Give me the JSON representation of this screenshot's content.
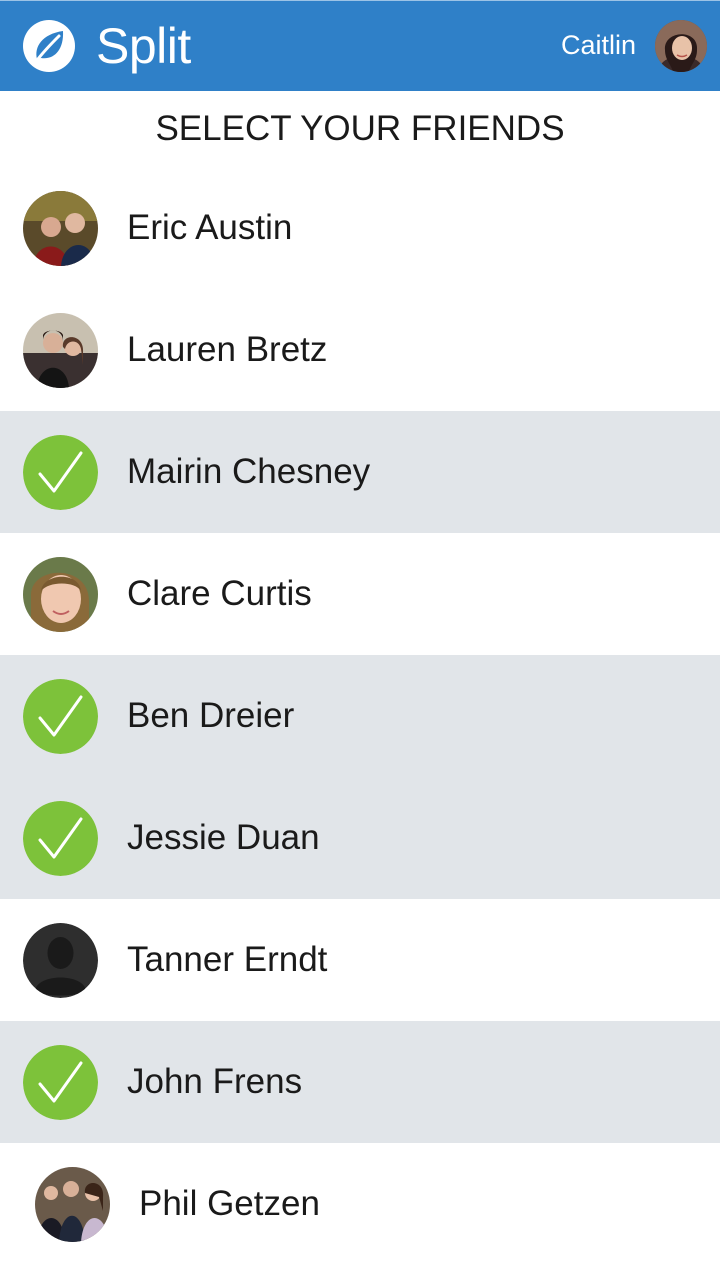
{
  "header": {
    "app_name": "Split",
    "logo_icon": "leaf-icon",
    "user_name": "Caitlin",
    "background_color": "#2f80c8"
  },
  "page": {
    "title": "SELECT YOUR FRIENDS"
  },
  "colors": {
    "selected_row": "#e1e5e9",
    "check_green": "#7dc23a"
  },
  "friends": [
    {
      "name": "Eric Austin",
      "selected": false
    },
    {
      "name": "Lauren Bretz",
      "selected": false
    },
    {
      "name": "Mairin Chesney",
      "selected": true
    },
    {
      "name": "Clare Curtis",
      "selected": false
    },
    {
      "name": "Ben Dreier",
      "selected": true
    },
    {
      "name": "Jessie Duan",
      "selected": true
    },
    {
      "name": "Tanner Erndt",
      "selected": false
    },
    {
      "name": "John Frens",
      "selected": true
    },
    {
      "name": "Phil Getzen",
      "selected": false
    }
  ]
}
